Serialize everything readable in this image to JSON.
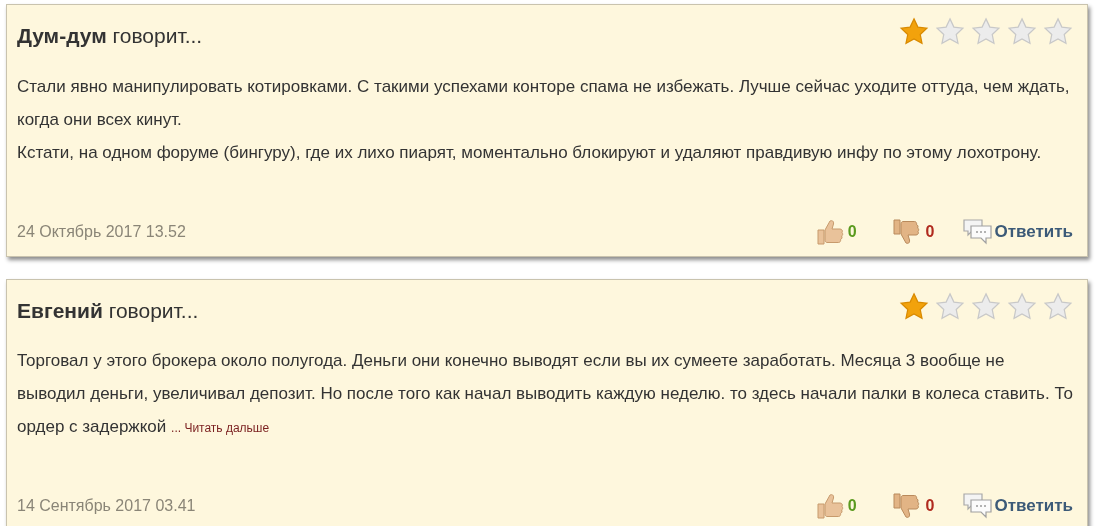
{
  "comments": [
    {
      "heading": "**Дум-дум** говорит...",
      "stars": 1,
      "paragraphs": [
        "Стали явно манипулировать котировками. С такими успехами конторе спама не избежать. Лучше сейчас уходите оттуда, чем ждать, когда они всех кинут.",
        "Кстати, на одном форуме (бингуру), где их лихо пиарят, моментально блокируют и удаляют правдивую инфу по этому лохотрону."
      ],
      "date": "24 Октябрь 2017 13.52",
      "likes": "0",
      "dislikes": "0",
      "reply": "Ответить"
    },
    {
      "heading": "**Евгений** говорит...",
      "stars": 1,
      "paragraphs": [
        "Торговал у этого брокера около полугода. Деньги они конечно выводят если вы их сумеете заработать. Месяца 3 вообще не выводил деньги, увеличивал депозит. Но после того как начал выводить каждую неделю. то здесь начали палки в колеса ставить. То ордер с задержкой"
      ],
      "read_more": "... Читать дальше",
      "date": "14 Сентябрь 2017 03.41",
      "likes": "0",
      "dislikes": "0",
      "reply": "Ответить"
    }
  ]
}
